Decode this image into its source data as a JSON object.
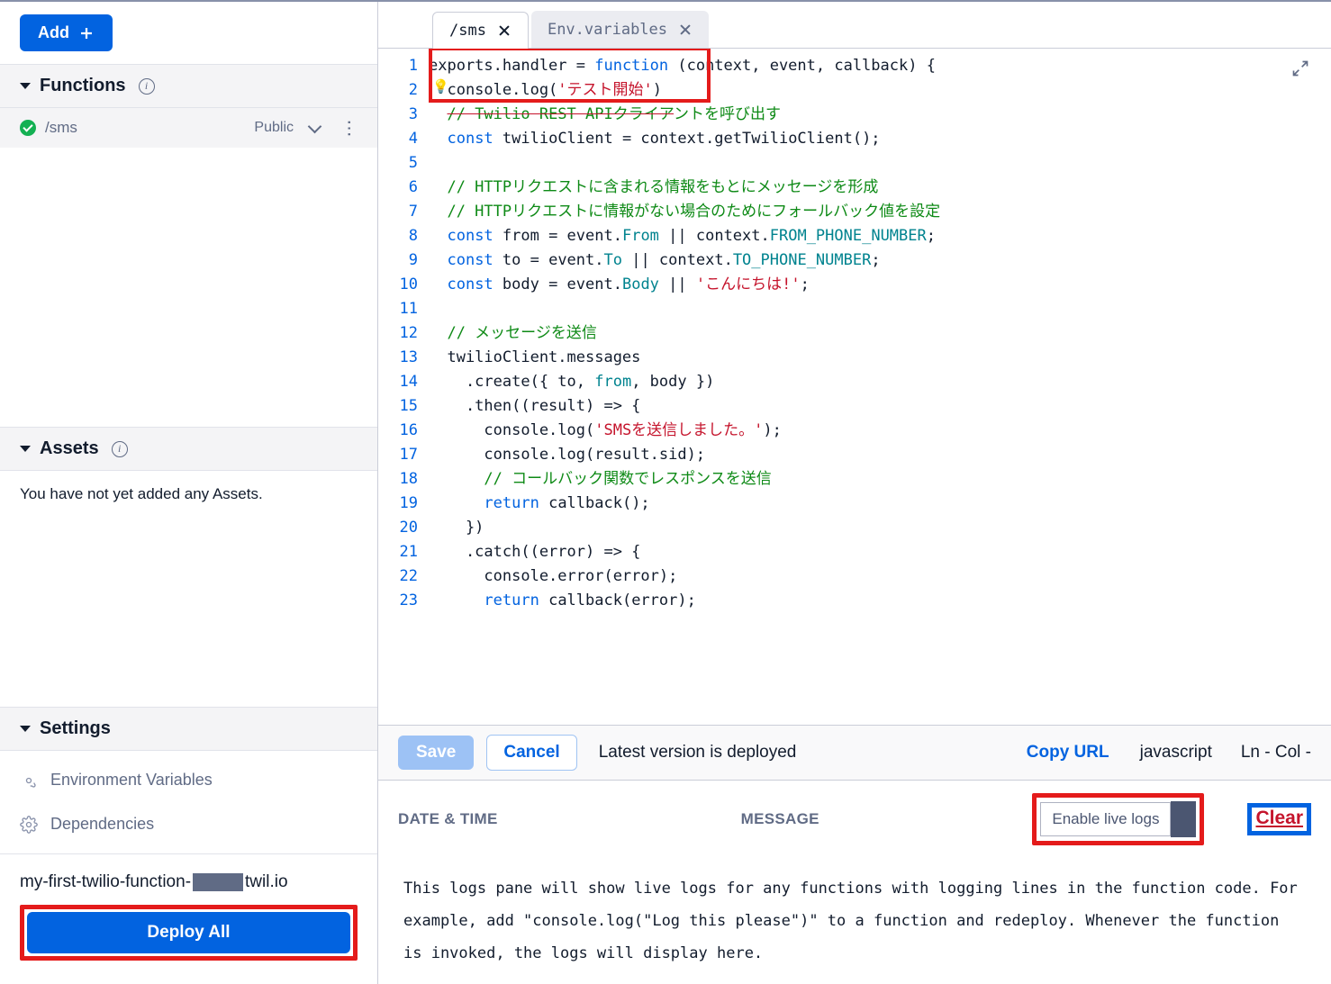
{
  "sidebar": {
    "add_label": "Add",
    "functions_title": "Functions",
    "function_item": {
      "name": "/sms",
      "visibility": "Public"
    },
    "assets_title": "Assets",
    "assets_empty": "You have not yet added any Assets.",
    "settings_title": "Settings",
    "settings_items": [
      "Environment Variables",
      "Dependencies"
    ],
    "domain_prefix": "my-first-twilio-function-",
    "domain_suffix": "twil.io",
    "deploy_all_label": "Deploy All"
  },
  "tabs": [
    {
      "label": "/sms",
      "active": true
    },
    {
      "label": "Env.variables",
      "active": false
    }
  ],
  "editor": {
    "lines": [
      "exports.handler = function (context, event, callback) {",
      "  console.log('テスト開始')",
      "  // Twilio REST APIクライアントを呼び出す",
      "  const twilioClient = context.getTwilioClient();",
      "",
      "  // HTTPリクエストに含まれる情報をもとにメッセージを形成",
      "  // HTTPリクエストに情報がない場合のためにフォールバック値を設定",
      "  const from = event.From || context.FROM_PHONE_NUMBER;",
      "  const to = event.To || context.TO_PHONE_NUMBER;",
      "  const body = event.Body || 'こんにちは!';",
      "",
      "  // メッセージを送信",
      "  twilioClient.messages",
      "    .create({ to, from, body })",
      "    .then((result) => {",
      "      console.log('SMSを送信しました。');",
      "      console.log(result.sid);",
      "      // コールバック関数でレスポンスを送信",
      "      return callback();",
      "    })",
      "    .catch((error) => {",
      "      console.error(error);",
      "      return callback(error);"
    ]
  },
  "toolbar": {
    "save": "Save",
    "cancel": "Cancel",
    "status": "Latest version is deployed",
    "copy_url": "Copy URL",
    "language": "javascript",
    "position": "Ln -  Col -"
  },
  "logs": {
    "col_date": "DATE & TIME",
    "col_msg": "MESSAGE",
    "toggle_label": "Enable live logs",
    "clear": "Clear",
    "body": "This logs pane will show live logs for any functions with logging lines in the function code. For example, add \"console.log(\"Log this please\")\" to a function and redeploy. Whenever the function is invoked, the logs will display here."
  }
}
